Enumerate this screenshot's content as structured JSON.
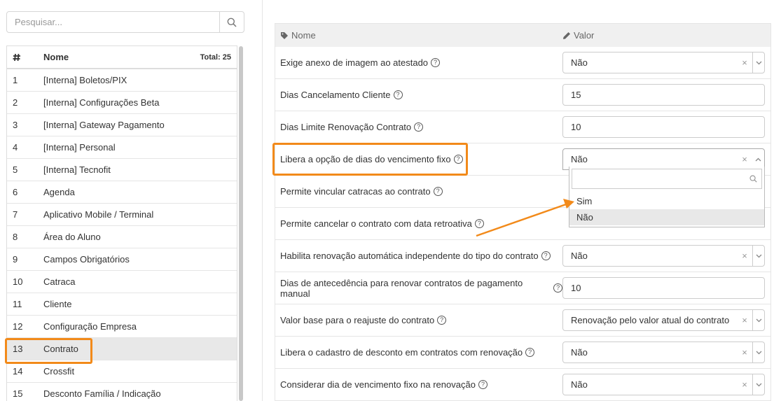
{
  "search": {
    "placeholder": "Pesquisar..."
  },
  "list": {
    "header": {
      "name": "Nome",
      "total": "Total: 25"
    },
    "items": [
      {
        "n": "1",
        "label": "[Interna] Boletos/PIX"
      },
      {
        "n": "2",
        "label": "[Interna] Configurações Beta"
      },
      {
        "n": "3",
        "label": "[Interna] Gateway Pagamento"
      },
      {
        "n": "4",
        "label": "[Interna] Personal"
      },
      {
        "n": "5",
        "label": "[Interna] Tecnofit"
      },
      {
        "n": "6",
        "label": "Agenda"
      },
      {
        "n": "7",
        "label": "Aplicativo Mobile / Terminal"
      },
      {
        "n": "8",
        "label": "Área do Aluno"
      },
      {
        "n": "9",
        "label": "Campos Obrigatórios"
      },
      {
        "n": "10",
        "label": "Catraca"
      },
      {
        "n": "11",
        "label": "Cliente"
      },
      {
        "n": "12",
        "label": "Configuração Empresa"
      },
      {
        "n": "13",
        "label": "Contrato"
      },
      {
        "n": "14",
        "label": "Crossfit"
      },
      {
        "n": "15",
        "label": "Desconto Família / Indicação"
      }
    ],
    "selected": "13"
  },
  "table": {
    "header": {
      "name": "Nome",
      "value": "Valor"
    },
    "rows": [
      {
        "label": "Exige anexo de imagem ao atestado",
        "value": "Não",
        "type": "select"
      },
      {
        "label": "Dias Cancelamento Cliente",
        "value": "15",
        "type": "input"
      },
      {
        "label": "Dias Limite Renovação Contrato",
        "value": "10",
        "type": "input"
      },
      {
        "label": "Libera a opção de dias do vencimento fixo",
        "value": "Não",
        "type": "select-open"
      },
      {
        "label": "Permite vincular catracas ao contrato",
        "value": "",
        "type": "none"
      },
      {
        "label": "Permite cancelar o contrato com data retroativa",
        "value": "",
        "type": "none"
      },
      {
        "label": "Habilita renovação automática independente do tipo do contrato",
        "value": "Não",
        "type": "select"
      },
      {
        "label": "Dias de antecedência para renovar contratos de pagamento manual",
        "value": "10",
        "type": "input"
      },
      {
        "label": "Valor base para o reajuste do contrato",
        "value": "Renovação pelo valor atual do contrato",
        "type": "select"
      },
      {
        "label": "Libera o cadastro de desconto em contratos com renovação",
        "value": "Não",
        "type": "select"
      },
      {
        "label": "Considerar dia de vencimento fixo na renovação",
        "value": "Não",
        "type": "select"
      }
    ]
  },
  "dropdown": {
    "options": [
      "Sim",
      "Não"
    ],
    "highlighted": "Não"
  },
  "colors": {
    "highlight": "#f28a1a",
    "selected_row": "#e8e8e8"
  },
  "icons": [
    "search-icon",
    "hash-icon",
    "tag-icon",
    "pencil-icon",
    "help-icon",
    "clear-icon",
    "chevron-down-icon",
    "chevron-up-icon"
  ]
}
